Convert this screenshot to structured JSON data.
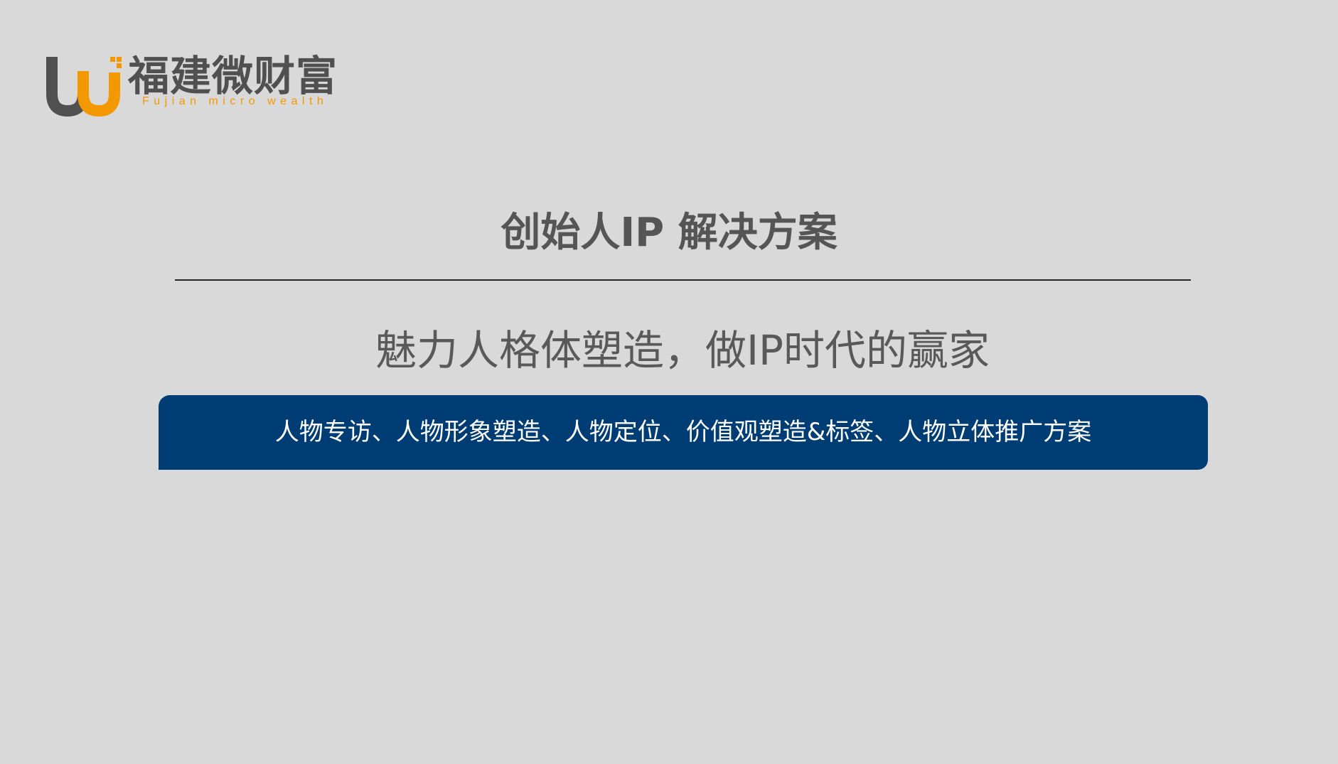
{
  "logo": {
    "name_cn": "福建微财富",
    "name_en": "Fujian micro wealth"
  },
  "slide": {
    "title": "创始人IP 解决方案",
    "subtitle": "魅力人格体塑造，做IP时代的赢家",
    "banner_text": "人物专访、人物形象塑造、人物定位、价值观塑造&标签、人物立体推广方案"
  },
  "colors": {
    "background": "#d9d9d9",
    "logo_gray": "#505050",
    "logo_orange": "#f39800",
    "title_text": "#555555",
    "subtitle_text": "#595959",
    "divider": "#262626",
    "banner_bg": "#003d75",
    "banner_text": "#ffffff"
  }
}
